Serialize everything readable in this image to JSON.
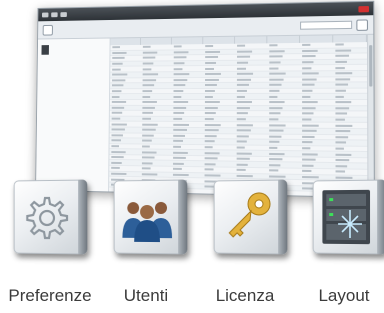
{
  "window": {
    "title_right": "",
    "left_panel": {
      "paragraphs": [
        "",
        ""
      ]
    },
    "table": {
      "columns": [
        "",
        "",
        "",
        "",
        "",
        "",
        "",
        ""
      ],
      "row_count": 26
    }
  },
  "tiles": [
    {
      "label": "Preferenze",
      "icon": "gear-icon"
    },
    {
      "label": "Utenti",
      "icon": "users-icon"
    },
    {
      "label": "Licenza",
      "icon": "key-icon"
    },
    {
      "label": "Layout",
      "icon": "server-rack-icon"
    }
  ]
}
